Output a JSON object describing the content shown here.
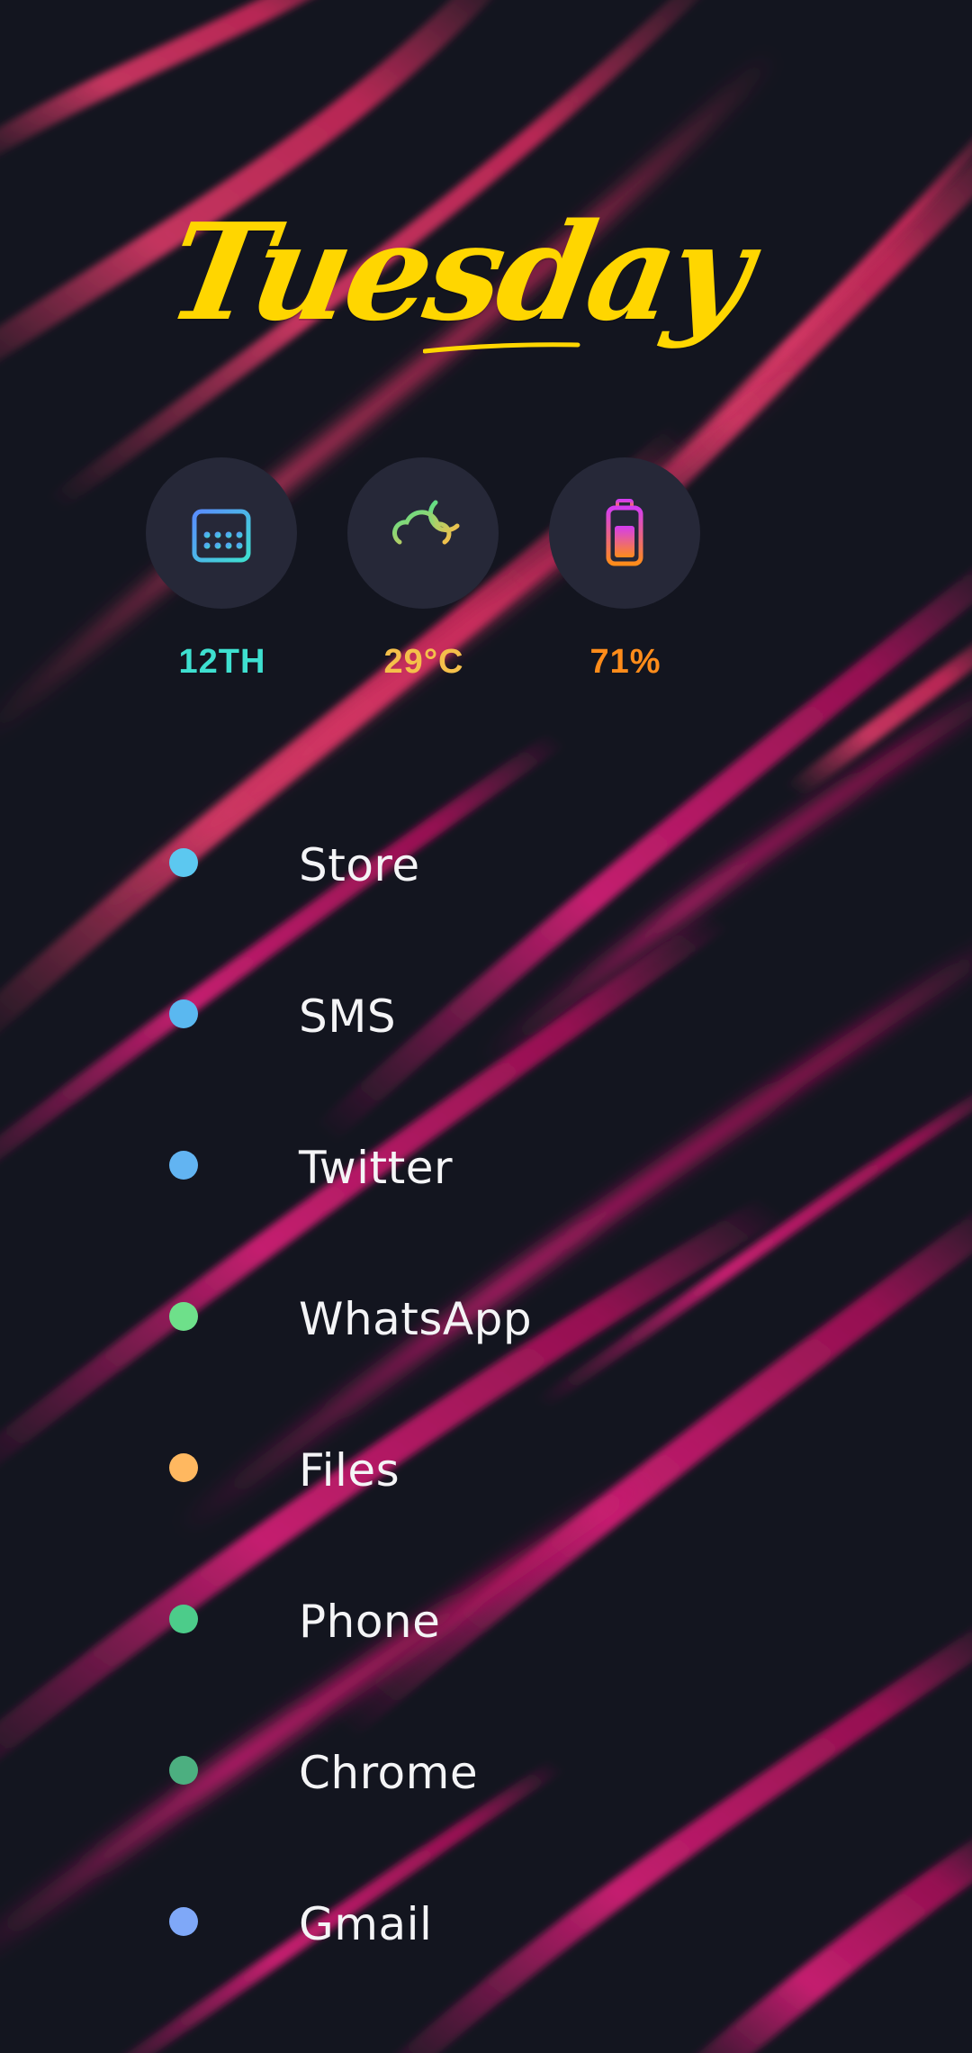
{
  "home": {
    "day": "Tuesday",
    "widgets": [
      {
        "icon": "calendar-icon",
        "value": "12TH",
        "color": "#3ee0d0"
      },
      {
        "icon": "partly-cloudy-night-icon",
        "value": "29°C",
        "color": "#f5c04a"
      },
      {
        "icon": "battery-icon",
        "value": "71%",
        "color": "#ff8c1a"
      }
    ]
  },
  "apps": [
    {
      "label": "Store",
      "color": "#5cc8f0"
    },
    {
      "label": "SMS",
      "color": "#5ab8f0"
    },
    {
      "label": "Twitter",
      "color": "#62b4f2"
    },
    {
      "label": "WhatsApp",
      "color": "#6ee08a"
    },
    {
      "label": "Files",
      "color": "#ffb860"
    },
    {
      "label": "Phone",
      "color": "#4ccc8a"
    },
    {
      "label": "Chrome",
      "color": "#4caf80"
    },
    {
      "label": "Gmail",
      "color": "#7fa8f8"
    }
  ],
  "theme": {
    "background": "#13151f",
    "accent_title": "#ffd600",
    "streak": "#e0306a"
  }
}
